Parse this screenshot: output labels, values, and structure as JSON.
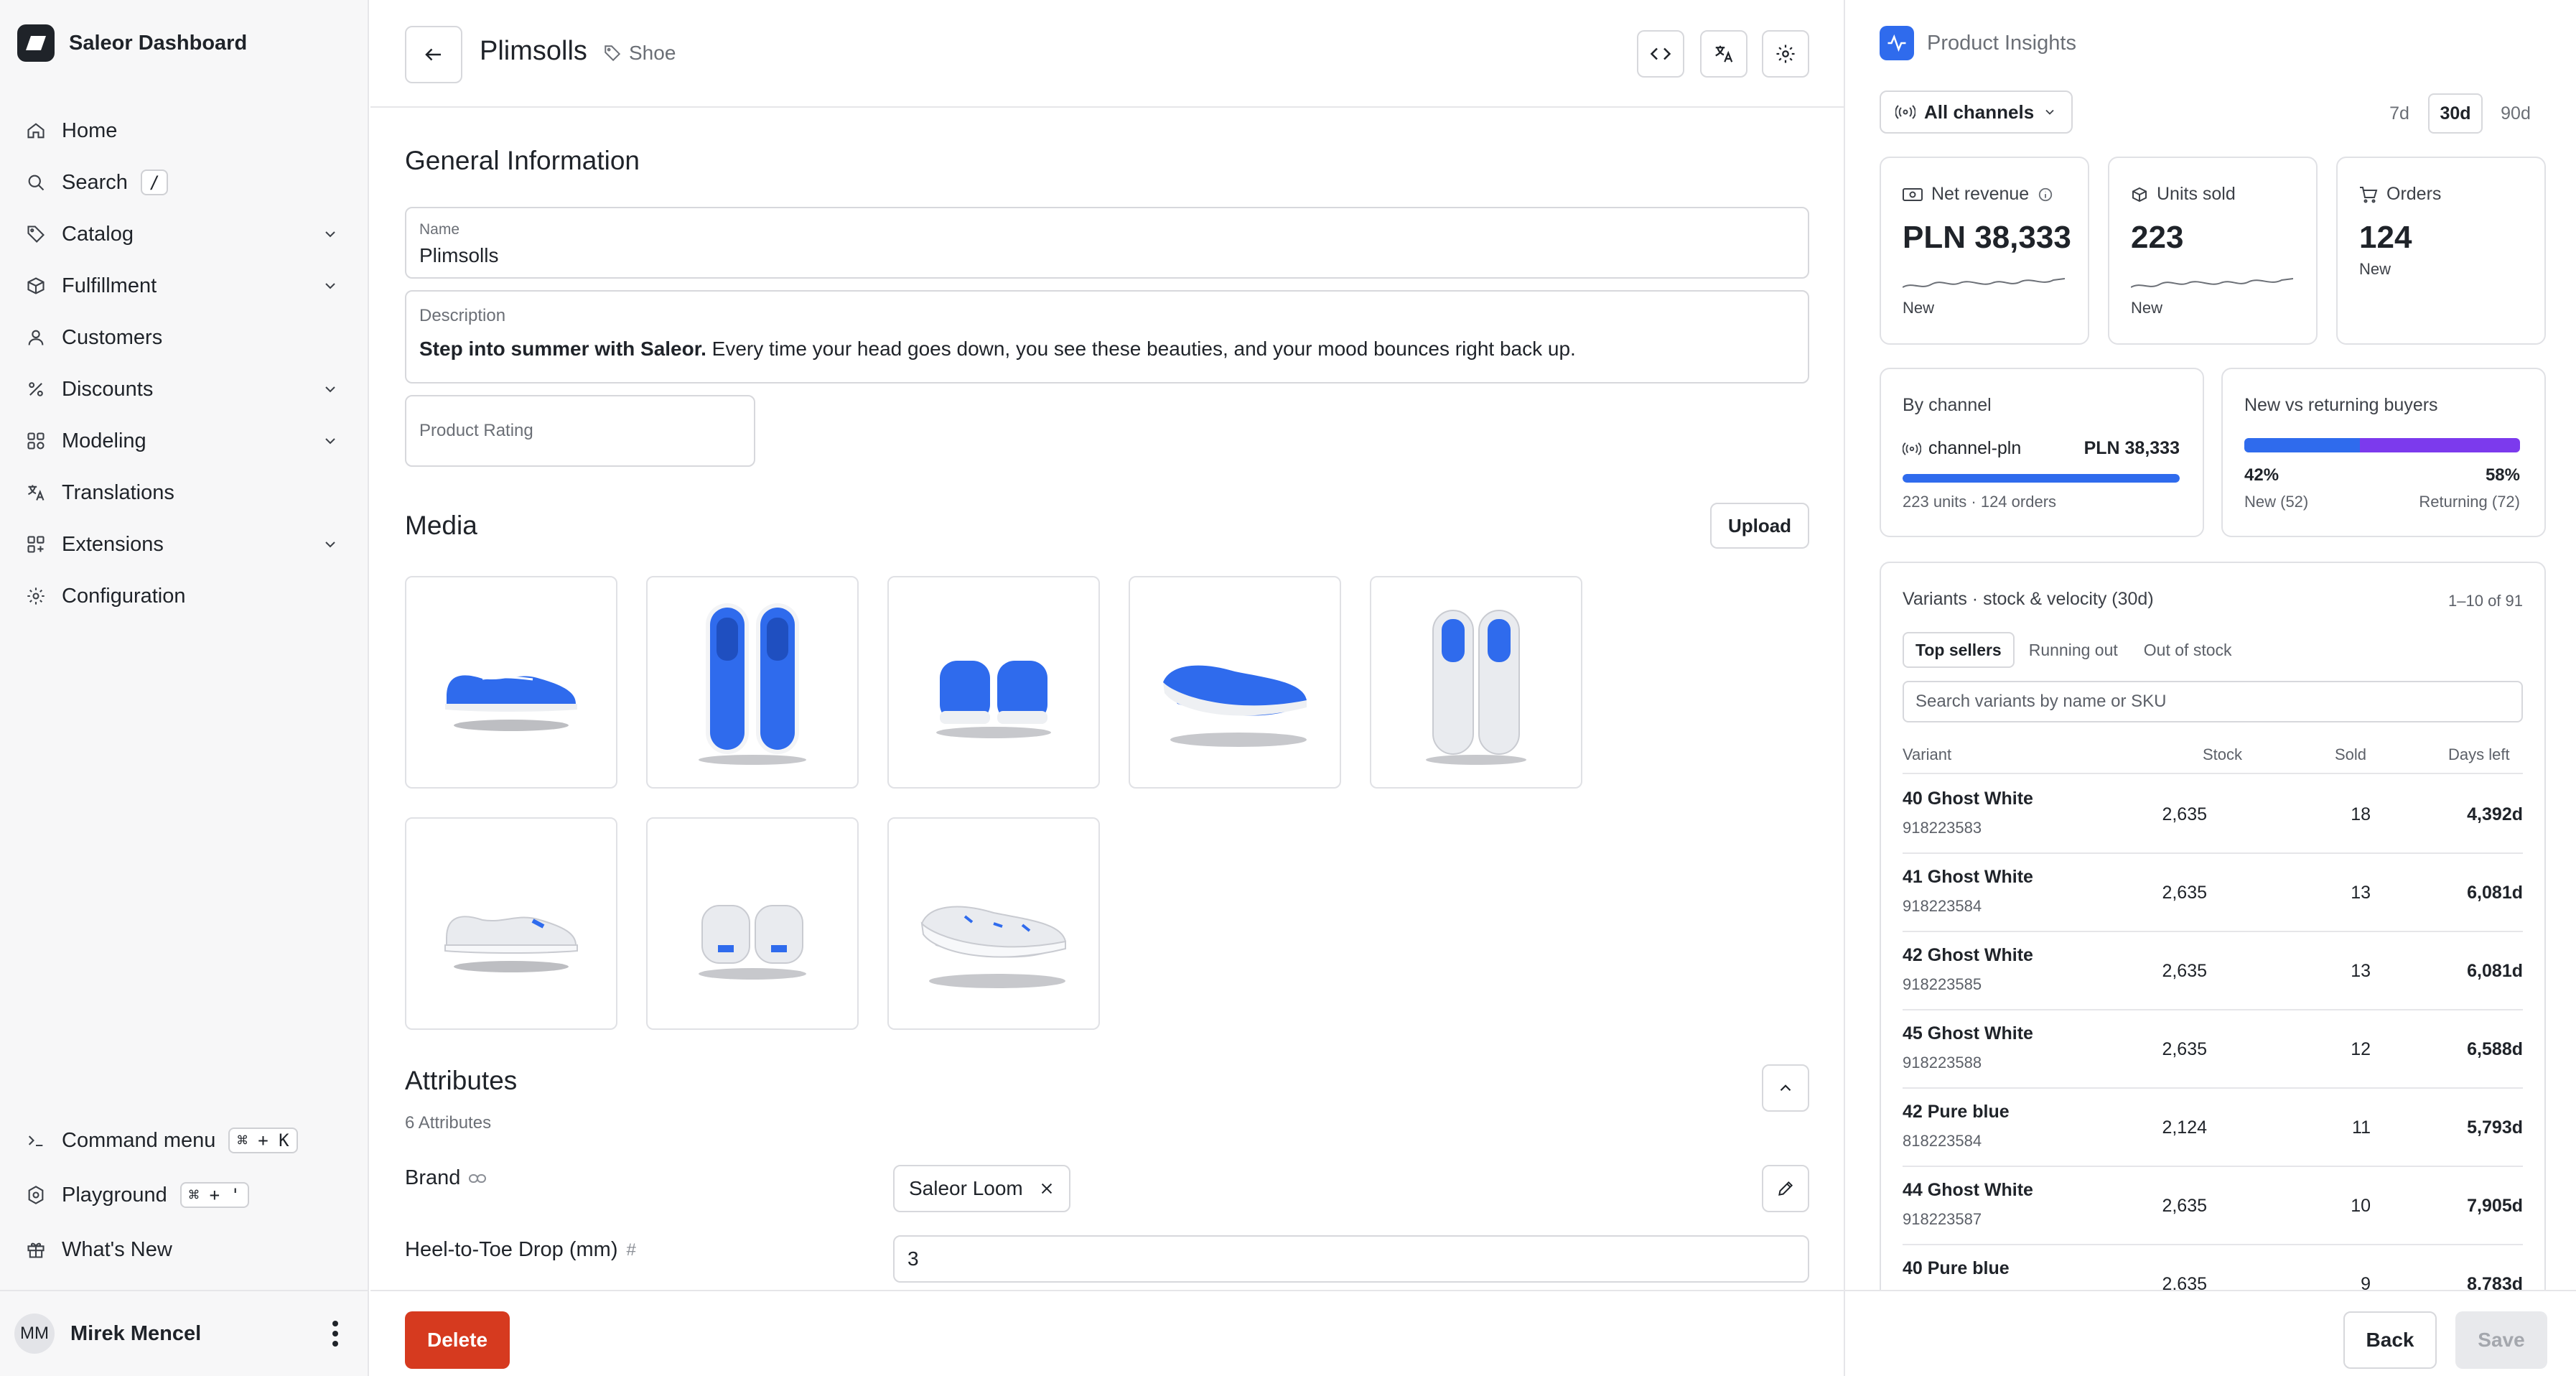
{
  "app": {
    "name": "Saleor Dashboard"
  },
  "sidebar": {
    "items": [
      {
        "label": "Home",
        "icon": "home-icon"
      },
      {
        "label": "Search",
        "icon": "search-icon",
        "shortcut": "/"
      },
      {
        "label": "Catalog",
        "icon": "tag-icon"
      },
      {
        "label": "Fulfillment",
        "icon": "box-icon"
      },
      {
        "label": "Customers",
        "icon": "user-icon"
      },
      {
        "label": "Discounts",
        "icon": "percent-icon"
      },
      {
        "label": "Modeling",
        "icon": "modeling-icon"
      },
      {
        "label": "Translations",
        "icon": "translate-icon"
      },
      {
        "label": "Extensions",
        "icon": "grid-plus-icon"
      },
      {
        "label": "Configuration",
        "icon": "gear-icon"
      }
    ],
    "bottom": [
      {
        "label": "Command menu",
        "shortcut": "⌘ + K",
        "icon": "terminal-icon"
      },
      {
        "label": "Playground",
        "shortcut": "⌘ + '",
        "icon": "playground-icon"
      },
      {
        "label": "What's New",
        "icon": "gift-icon"
      }
    ],
    "user": {
      "initials": "MM",
      "name": "Mirek Mencel"
    }
  },
  "product": {
    "title": "Plimsolls",
    "type": "Shoe"
  },
  "general": {
    "title": "General Information",
    "name_label": "Name",
    "name_value": "Plimsolls",
    "description_label": "Description",
    "description_strong": "Step into summer with Saleor.",
    "description_rest": " Every time your head goes down, you see these beauties, and your mood bounces right back up.",
    "rating_placeholder": "Product Rating"
  },
  "media": {
    "title": "Media",
    "upload_label": "Upload"
  },
  "attributes": {
    "title": "Attributes",
    "count_label": "6 Attributes",
    "brand_label": "Brand",
    "brand_value": "Saleor Loom",
    "drop_label": "Heel-to-Toe Drop (mm)",
    "drop_value": "3"
  },
  "footer": {
    "delete_label": "Delete",
    "back_label": "Back",
    "save_label": "Save"
  },
  "insights": {
    "title": "Product Insights",
    "channel_select": "All channels",
    "ranges": [
      "7d",
      "30d",
      "90d"
    ],
    "active_range": "30d",
    "kpis": {
      "revenue": {
        "label": "Net revenue",
        "value": "PLN 38,333",
        "note": "New"
      },
      "units": {
        "label": "Units sold",
        "value": "223",
        "note": "New"
      },
      "orders": {
        "label": "Orders",
        "value": "124",
        "note": "New"
      }
    },
    "by_channel": {
      "title": "By channel",
      "channel": "channel-pln",
      "value": "PLN 38,333",
      "share": 1.0,
      "meta": "223 units · 124 orders"
    },
    "buyers": {
      "title": "New vs returning buyers",
      "new_pct": "42%",
      "returning_pct": "58%",
      "new_share": 0.42,
      "new_label": "New (52)",
      "returning_label": "Returning (72)"
    },
    "variants": {
      "title": "Variants · stock & velocity (30d)",
      "count": "1–10 of 91",
      "tabs": [
        "Top sellers",
        "Running out",
        "Out of stock"
      ],
      "search_placeholder": "Search variants by name or SKU",
      "columns": [
        "Variant",
        "Stock",
        "Sold",
        "Days left"
      ],
      "rows": [
        {
          "name": "40 Ghost White",
          "sku": "918223583",
          "stock": "2,635",
          "sold": "18",
          "days": "4,392d"
        },
        {
          "name": "41 Ghost White",
          "sku": "918223584",
          "stock": "2,635",
          "sold": "13",
          "days": "6,081d"
        },
        {
          "name": "42 Ghost White",
          "sku": "918223585",
          "stock": "2,635",
          "sold": "13",
          "days": "6,081d"
        },
        {
          "name": "45 Ghost White",
          "sku": "918223588",
          "stock": "2,635",
          "sold": "12",
          "days": "6,588d"
        },
        {
          "name": "42 Pure blue",
          "sku": "818223584",
          "stock": "2,124",
          "sold": "11",
          "days": "5,793d"
        },
        {
          "name": "44 Ghost White",
          "sku": "918223587",
          "stock": "2,635",
          "sold": "10",
          "days": "7,905d"
        },
        {
          "name": "40 Pure blue",
          "sku": "",
          "stock": "2,635",
          "sold": "9",
          "days": "8,783d"
        }
      ]
    }
  },
  "colors": {
    "accent": "#2f6bed",
    "returning": "#7c3aed",
    "danger": "#d63a1f"
  }
}
